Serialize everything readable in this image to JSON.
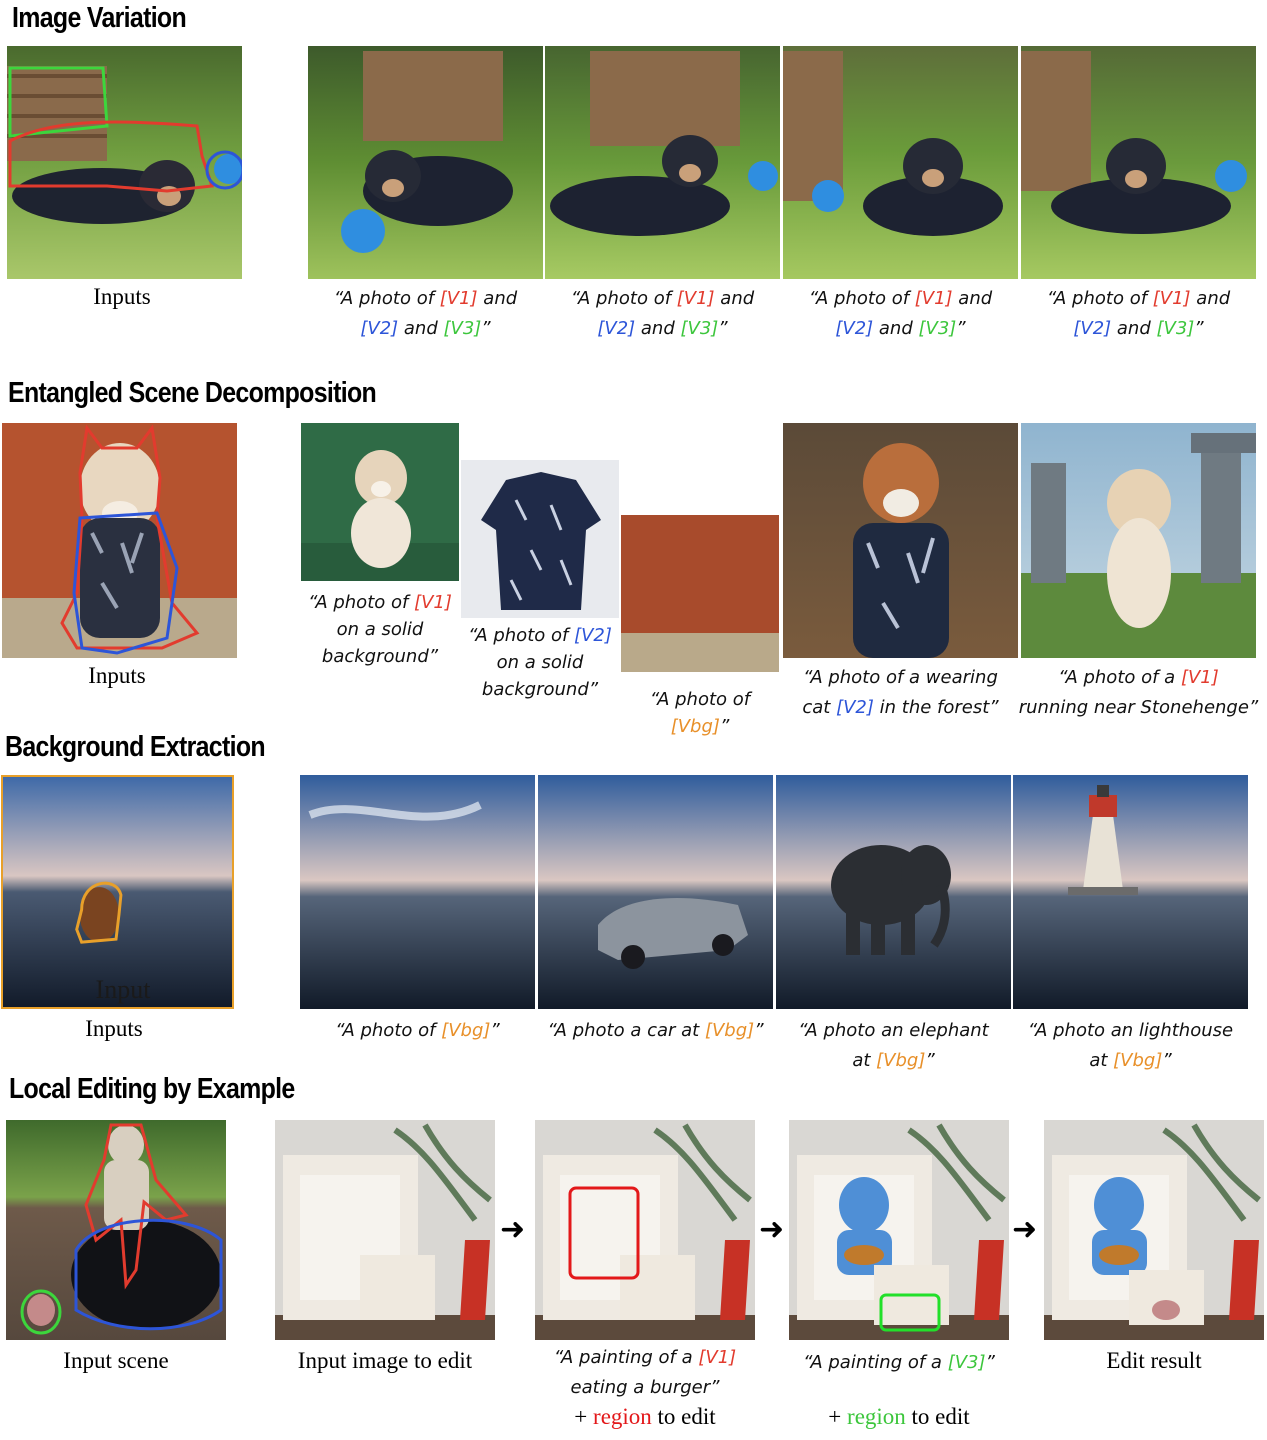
{
  "sections": {
    "s1": "Image Variation",
    "s2": "Entangled Scene Decomposition",
    "s3": "Background Extraction",
    "s4": "Local Editing by Example"
  },
  "labels": {
    "inputs": "Inputs",
    "input_overlay": "Input",
    "input_scene": "Input scene",
    "input_image_to_edit": "Input image to edit",
    "edit_result": "Edit result",
    "plus_region": "+ ",
    "region": "region",
    "to_edit": " to edit"
  },
  "captions": {
    "variation": {
      "p1": "“A photo of ",
      "v1": "[V1]",
      "p2": " and",
      "v2": "[V2]",
      "p3": " and ",
      "v3": "[V3]",
      "p4": "”"
    },
    "dec1": {
      "p1": "“A photo of ",
      "v": "[V1]",
      "p2": "on a solid",
      "p3": "background”"
    },
    "dec2": {
      "p1": "“A photo of ",
      "v": "[V2]",
      "p2": "on a solid",
      "p3": "background”"
    },
    "dec3": {
      "p1": "“A photo of",
      "v": "[Vbg]",
      "p2": "”"
    },
    "dec4": {
      "p1": "“A photo of a wearing",
      "p2": "cat ",
      "v": "[V2]",
      "p3": " in the forest”"
    },
    "dec5": {
      "p1": "“A photo of a ",
      "v": "[V1]",
      "p2": "running near Stonehenge”"
    },
    "bg1": {
      "p1": "“A photo of ",
      "v": "[Vbg]",
      "p2": "”"
    },
    "bg2": {
      "p1": "“A photo a car at ",
      "v": "[Vbg]",
      "p2": "”"
    },
    "bg3": {
      "p1": "“A photo an elephant",
      "p2": "at ",
      "v": "[Vbg]",
      "p3": "”"
    },
    "bg4": {
      "p1": "“A photo an lighthouse",
      "p2": "at ",
      "v": "[Vbg]",
      "p3": "”"
    },
    "edit1": {
      "p1": "“A painting of a ",
      "v": "[V1]",
      "p2": "eating a burger”"
    },
    "edit2": {
      "p1": "“A painting of a ",
      "v": "[V3]",
      "p2": "”"
    }
  },
  "colors": {
    "red": "#e23b2e",
    "blue": "#2d55d8",
    "green": "#3cc63c",
    "orange": "#e8902a"
  }
}
